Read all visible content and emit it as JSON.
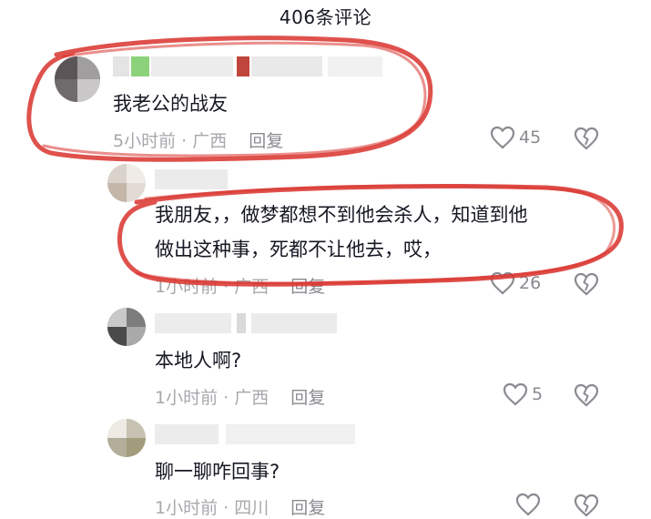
{
  "header": {
    "title": "406条评论"
  },
  "comments": [
    {
      "text": "我老公的战友",
      "meta": "5小时前 · 广西",
      "reply": "回复",
      "likes": "45"
    },
    {
      "text_line1": "我朋友，，做梦都想不到他会杀人，知道到他",
      "text_line2": "做出这种事，死都不让他去，哎，",
      "meta": "1小时前 · 广西",
      "reply": "回复",
      "likes": "26"
    },
    {
      "text": "本地人啊?",
      "meta": "1小时前 · 广西",
      "reply": "回复",
      "likes": "5"
    },
    {
      "text": "聊一聊咋回事?",
      "meta": "1小时前 · 四川",
      "reply": "回复",
      "likes": ""
    }
  ],
  "colors": {
    "annotation": "#d9332d",
    "text": "#161823",
    "meta": "#a8a8ad"
  }
}
